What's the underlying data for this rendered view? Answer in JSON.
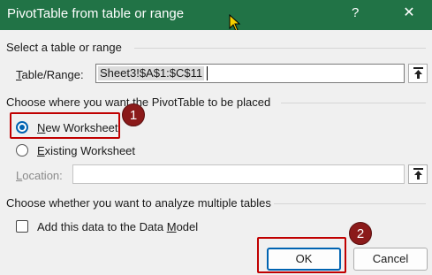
{
  "window": {
    "title": "PivotTable from table or range",
    "help_glyph": "?",
    "close_glyph": "✕"
  },
  "section_table": {
    "heading": "Select a table or range",
    "field_label_mnemonic": "T",
    "field_label_rest": "able/Range:",
    "range_value": "Sheet3!$A$1:$C$11"
  },
  "section_placement": {
    "heading": "Choose where you want the PivotTable to be placed",
    "new_worksheet": {
      "mnemonic": "N",
      "rest": "ew Worksheet",
      "checked": true
    },
    "existing_worksheet": {
      "mnemonic": "E",
      "rest": "xisting Worksheet",
      "checked": false
    },
    "location_label_mnemonic": "L",
    "location_label_rest": "ocation:",
    "location_value": ""
  },
  "section_multiple": {
    "heading": "Choose whether you want to analyze multiple tables",
    "data_model_label_mnemonic": "M",
    "data_model_label_before": "Add this data to the Data ",
    "data_model_label_after": "odel",
    "checked": false
  },
  "buttons": {
    "ok": "OK",
    "cancel": "Cancel"
  },
  "annotations": {
    "badge_1": "1",
    "badge_2": "2",
    "highlight_color": "#c00000",
    "badge_color": "#8b1a1a"
  },
  "colors": {
    "titlebar": "#217346",
    "dialog_bg": "#f0f0f0",
    "accent": "#0063b1"
  }
}
